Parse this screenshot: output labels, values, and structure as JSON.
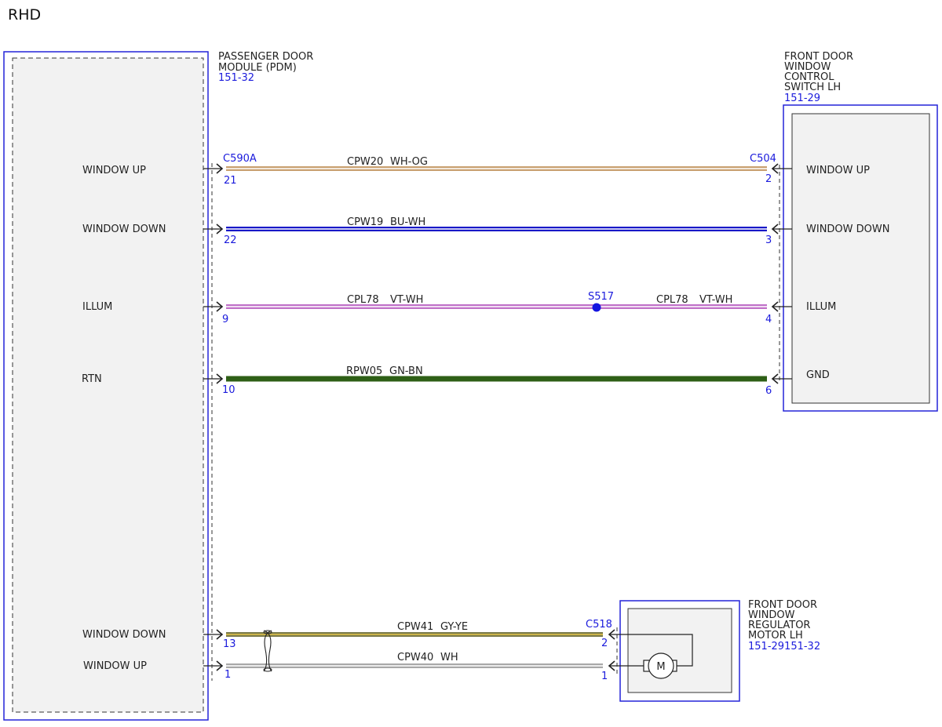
{
  "title": "RHD",
  "colors": {
    "module_frame": "#2424d8",
    "module_fill": "#f2f2f2",
    "splice_dot": "#1515e0",
    "connector_text": "#1a1adc"
  },
  "modules": {
    "pdm": {
      "name_line1": "PASSENGER DOOR",
      "name_line2": "MODULE (PDM)",
      "ref": "151-32",
      "pins": {
        "window_up": "WINDOW UP",
        "window_down": "WINDOW DOWN",
        "illum": "ILLUM",
        "rtn": "RTN",
        "window_down_2": "WINDOW DOWN",
        "window_up_2": "WINDOW UP"
      }
    },
    "switch": {
      "name_line1": "FRONT DOOR",
      "name_line2": "WINDOW",
      "name_line3": "CONTROL",
      "name_line4": "SWITCH LH",
      "ref": "151-29",
      "pins": {
        "window_up": "WINDOW UP",
        "window_down": "WINDOW DOWN",
        "illum": "ILLUM",
        "gnd": "GND"
      }
    },
    "motor": {
      "name_line1": "FRONT DOOR",
      "name_line2": "WINDOW",
      "name_line3": "REGULATOR",
      "name_line4": "MOTOR LH",
      "ref": "151-29151-32",
      "symbol": "M"
    }
  },
  "connectors": {
    "pdm": "C590A",
    "switch": "C504",
    "motor": "C518",
    "splice": "S517"
  },
  "wires": {
    "w1": {
      "circuit": "CPW20",
      "color_code": "WH-OG",
      "pin_left": "21",
      "pin_right": "2",
      "base": "#c8a070",
      "stripe": "#ffffff"
    },
    "w2": {
      "circuit": "CPW19",
      "color_code": "BU-WH",
      "pin_left": "22",
      "pin_right": "3",
      "base": "#1818c8",
      "stripe": "#ffffff"
    },
    "w3": {
      "circuit": "CPL78",
      "color_code": "VT-WH",
      "circuit_right": "CPL78",
      "color_code_right": "VT-WH",
      "pin_left": "9",
      "pin_right": "4",
      "base": "#c070c8",
      "stripe": "#ffffff"
    },
    "w4": {
      "circuit": "RPW05",
      "color_code": "GN-BN",
      "pin_left": "10",
      "pin_right": "6",
      "base": "#2e5f16",
      "stripe": "#2e5f16"
    },
    "w5": {
      "circuit": "CPW41",
      "color_code": "GY-YE",
      "pin_left": "13",
      "pin_right": "2",
      "base": "#7a7a4a",
      "stripe": "#e6c84a"
    },
    "w6": {
      "circuit": "CPW40",
      "color_code": "WH",
      "pin_left": "1",
      "pin_right": "1",
      "base": "#a8a8a8",
      "stripe": "#ffffff"
    }
  }
}
